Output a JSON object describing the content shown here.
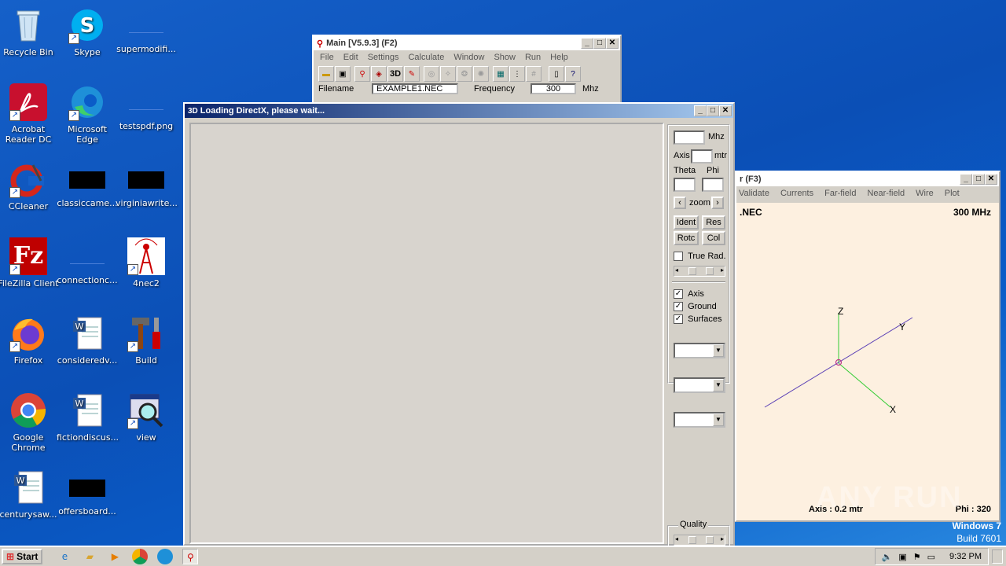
{
  "desktop": {
    "icons": [
      {
        "label": "Recycle Bin"
      },
      {
        "label": "Skype"
      },
      {
        "label": "supermodifi..."
      },
      {
        "label": "Acrobat Reader DC"
      },
      {
        "label": "Microsoft Edge"
      },
      {
        "label": "testspdf.png"
      },
      {
        "label": "CCleaner"
      },
      {
        "label": "classiccame..."
      },
      {
        "label": "virginiawrite..."
      },
      {
        "label": "FileZilla Client"
      },
      {
        "label": "connectionc..."
      },
      {
        "label": "4nec2"
      },
      {
        "label": "Firefox"
      },
      {
        "label": "consideredv..."
      },
      {
        "label": "Build"
      },
      {
        "label": "Google Chrome"
      },
      {
        "label": "fictiondiscus..."
      },
      {
        "label": "view"
      },
      {
        "label": "centurysaw..."
      },
      {
        "label": "offersboard..."
      }
    ],
    "watermark": {
      "os_name": "Windows 7",
      "build": "Build 7601"
    }
  },
  "main_window": {
    "title": "Main [V5.9.3]  (F2)",
    "menu": [
      "File",
      "Edit",
      "Settings",
      "Calculate",
      "Window",
      "Show",
      "Run",
      "Help"
    ],
    "filename_label": "Filename",
    "filename_value": "EXAMPLE1.NEC",
    "frequency_label": "Frequency",
    "frequency_value": "300",
    "frequency_unit": "Mhz",
    "toolbar_3d": "3D"
  },
  "directx_window": {
    "title": "Loading DirectX, please wait...",
    "mhz_unit": "Mhz",
    "axis_label": "Axis",
    "axis_unit": "mtr",
    "theta_label": "Theta",
    "phi_label": "Phi",
    "zoom_label": "zoom",
    "ident_btn": "Ident",
    "res_btn": "Res",
    "rotc_btn": "Rotc",
    "col_btn": "Col",
    "true_rad_label": "True Rad.",
    "axis_check_label": "Axis",
    "ground_check_label": "Ground",
    "surfaces_check_label": "Surfaces",
    "quality_label": "Quality"
  },
  "geometry_window": {
    "title": "r  (F3)",
    "menu": [
      "Validate",
      "Currents",
      "Far-field",
      "Near-field",
      "Wire",
      "Plot"
    ],
    "file_label": ".NEC",
    "freq_label": "300 MHz",
    "axis_z": "Z",
    "axis_y": "Y",
    "axis_x": "X",
    "axis_info": "Axis : 0.2 mtr",
    "phi_info": "Phi : 320"
  },
  "taskbar": {
    "start_label": "Start",
    "clock": "9:32 PM"
  },
  "watermark_text": "ANY RUN"
}
